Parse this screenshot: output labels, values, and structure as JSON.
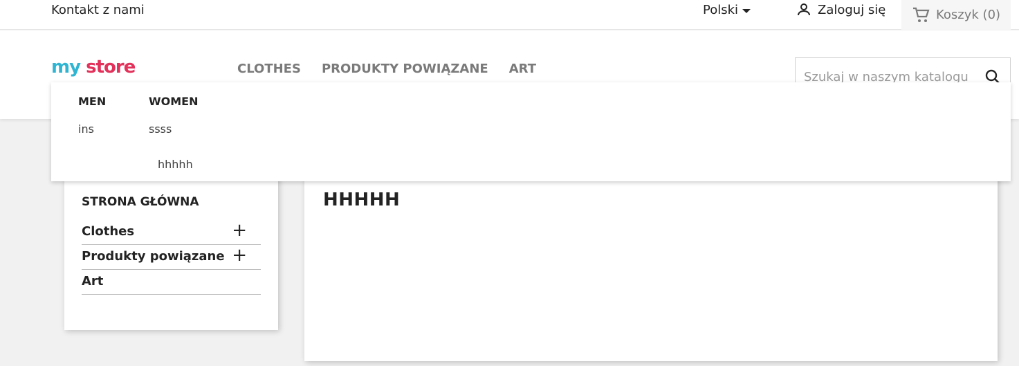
{
  "topbar": {
    "contact": "Kontakt z nami",
    "language": "Polski",
    "login": "Zaloguj się",
    "cart": "Koszyk (0)"
  },
  "header": {
    "logo": {
      "part1": "my",
      "part2": "store"
    },
    "nav": [
      "CLOTHES",
      "PRODUKTY POWIĄZANE",
      "ART"
    ],
    "search_placeholder": "Szukaj w naszym katalogu"
  },
  "dropdown": {
    "columns": [
      {
        "title": "MEN",
        "items": [
          "ins"
        ]
      },
      {
        "title": "WOMEN",
        "items": [
          "ssss",
          "hhhhh"
        ]
      }
    ]
  },
  "sidebar": {
    "home": "STRONA GŁÓWNA",
    "categories": [
      {
        "label": "Clothes",
        "expand": "+"
      },
      {
        "label": "Produkty powiązane",
        "expand": "+"
      },
      {
        "label": "Art",
        "expand": ""
      }
    ]
  },
  "main": {
    "title": "HHHHH"
  },
  "colors": {
    "logo_blue": "#2fb5d2",
    "logo_red": "#e2315a",
    "text": "#232323",
    "muted": "#7a7a7a"
  }
}
